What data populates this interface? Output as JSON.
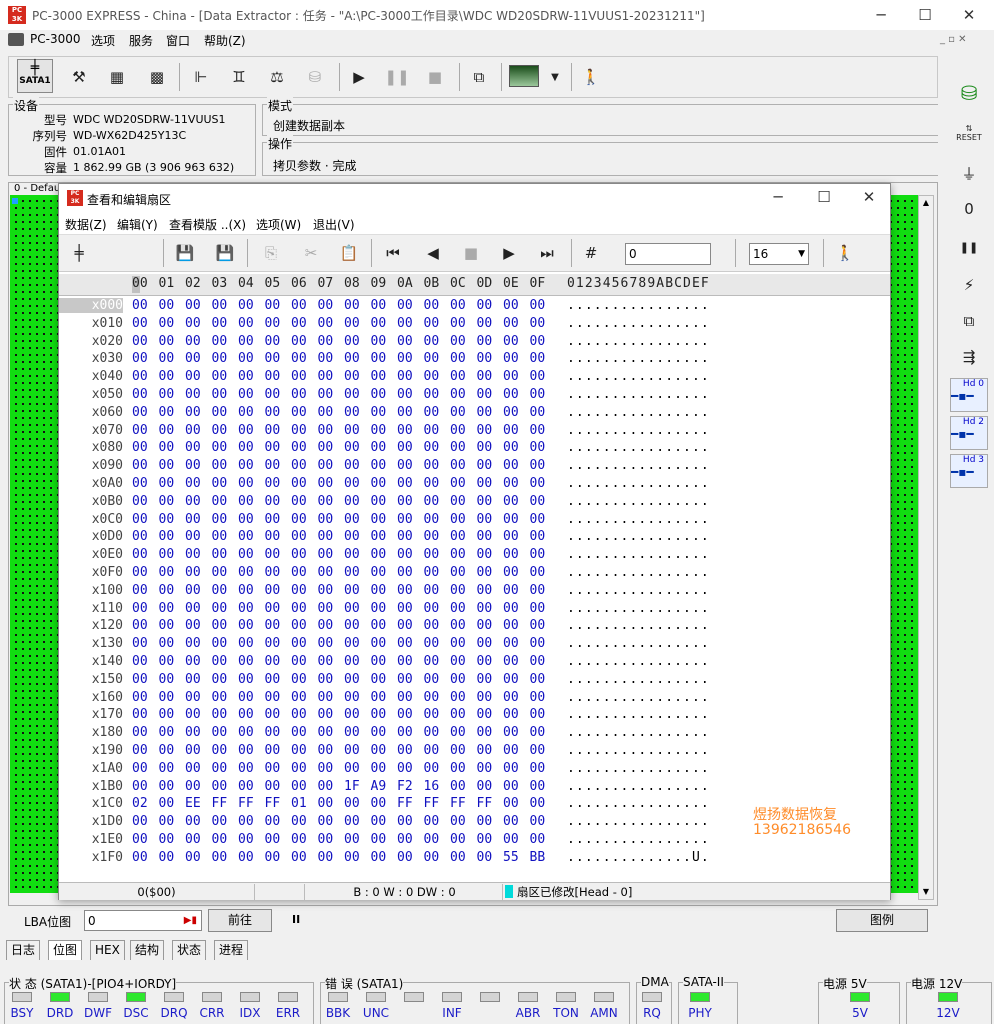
{
  "window": {
    "title": "PC-3000 EXPRESS - China - [Data Extractor : 任务 - \"A:\\PC-3000工作目录\\WDC WD20SDRW-11VUUS1-20231211\"]",
    "min": "─",
    "max": "☐",
    "close": "✕",
    "logo": "PC\n3K"
  },
  "menubar": {
    "items": [
      "PC-3000",
      "选项",
      "服务",
      "窗口",
      "帮助(Z)"
    ],
    "mdi": "_ ▫ ✕"
  },
  "toolbar": {
    "sata_label": "SATA1"
  },
  "device": {
    "group_label": "设备",
    "fields": [
      {
        "label": "型号",
        "value": "WDC WD20SDRW-11VUUS1"
      },
      {
        "label": "序列号",
        "value": "WD-WX62D425Y13C"
      },
      {
        "label": "固件",
        "value": "01.01A01"
      },
      {
        "label": "容量",
        "value": "1 862.99 GB (3 906 963 632)"
      }
    ]
  },
  "mode": {
    "group_label": "模式",
    "value": "创建数据副本"
  },
  "operation": {
    "group_label": "操作",
    "value": "拷贝参数 · 完成"
  },
  "bitmap_label": "0 - Defau",
  "dialog": {
    "title": "查看和编辑扇区",
    "menu": [
      "数据(Z)",
      "编辑(Y)",
      "查看模版 ..(X)",
      "选项(W)",
      "退出(V)"
    ],
    "offset_value": "0",
    "cols_value": "16",
    "header_cols": [
      "00",
      "01",
      "02",
      "03",
      "04",
      "05",
      "06",
      "07",
      "08",
      "09",
      "0A",
      "0B",
      "0C",
      "0D",
      "0E",
      "0F"
    ],
    "ascii_header": "0123456789ABCDEF",
    "rows": [
      {
        "addr": "x000",
        "bytes": [
          "00",
          "00",
          "00",
          "00",
          "00",
          "00",
          "00",
          "00",
          "00",
          "00",
          "00",
          "00",
          "00",
          "00",
          "00",
          "00"
        ],
        "ascii": "................"
      },
      {
        "addr": "x010",
        "bytes": [
          "00",
          "00",
          "00",
          "00",
          "00",
          "00",
          "00",
          "00",
          "00",
          "00",
          "00",
          "00",
          "00",
          "00",
          "00",
          "00"
        ],
        "ascii": "................"
      },
      {
        "addr": "x020",
        "bytes": [
          "00",
          "00",
          "00",
          "00",
          "00",
          "00",
          "00",
          "00",
          "00",
          "00",
          "00",
          "00",
          "00",
          "00",
          "00",
          "00"
        ],
        "ascii": "................"
      },
      {
        "addr": "x030",
        "bytes": [
          "00",
          "00",
          "00",
          "00",
          "00",
          "00",
          "00",
          "00",
          "00",
          "00",
          "00",
          "00",
          "00",
          "00",
          "00",
          "00"
        ],
        "ascii": "................"
      },
      {
        "addr": "x040",
        "bytes": [
          "00",
          "00",
          "00",
          "00",
          "00",
          "00",
          "00",
          "00",
          "00",
          "00",
          "00",
          "00",
          "00",
          "00",
          "00",
          "00"
        ],
        "ascii": "................"
      },
      {
        "addr": "x050",
        "bytes": [
          "00",
          "00",
          "00",
          "00",
          "00",
          "00",
          "00",
          "00",
          "00",
          "00",
          "00",
          "00",
          "00",
          "00",
          "00",
          "00"
        ],
        "ascii": "................"
      },
      {
        "addr": "x060",
        "bytes": [
          "00",
          "00",
          "00",
          "00",
          "00",
          "00",
          "00",
          "00",
          "00",
          "00",
          "00",
          "00",
          "00",
          "00",
          "00",
          "00"
        ],
        "ascii": "................"
      },
      {
        "addr": "x070",
        "bytes": [
          "00",
          "00",
          "00",
          "00",
          "00",
          "00",
          "00",
          "00",
          "00",
          "00",
          "00",
          "00",
          "00",
          "00",
          "00",
          "00"
        ],
        "ascii": "................"
      },
      {
        "addr": "x080",
        "bytes": [
          "00",
          "00",
          "00",
          "00",
          "00",
          "00",
          "00",
          "00",
          "00",
          "00",
          "00",
          "00",
          "00",
          "00",
          "00",
          "00"
        ],
        "ascii": "................"
      },
      {
        "addr": "x090",
        "bytes": [
          "00",
          "00",
          "00",
          "00",
          "00",
          "00",
          "00",
          "00",
          "00",
          "00",
          "00",
          "00",
          "00",
          "00",
          "00",
          "00"
        ],
        "ascii": "................"
      },
      {
        "addr": "x0A0",
        "bytes": [
          "00",
          "00",
          "00",
          "00",
          "00",
          "00",
          "00",
          "00",
          "00",
          "00",
          "00",
          "00",
          "00",
          "00",
          "00",
          "00"
        ],
        "ascii": "................"
      },
      {
        "addr": "x0B0",
        "bytes": [
          "00",
          "00",
          "00",
          "00",
          "00",
          "00",
          "00",
          "00",
          "00",
          "00",
          "00",
          "00",
          "00",
          "00",
          "00",
          "00"
        ],
        "ascii": "................"
      },
      {
        "addr": "x0C0",
        "bytes": [
          "00",
          "00",
          "00",
          "00",
          "00",
          "00",
          "00",
          "00",
          "00",
          "00",
          "00",
          "00",
          "00",
          "00",
          "00",
          "00"
        ],
        "ascii": "................"
      },
      {
        "addr": "x0D0",
        "bytes": [
          "00",
          "00",
          "00",
          "00",
          "00",
          "00",
          "00",
          "00",
          "00",
          "00",
          "00",
          "00",
          "00",
          "00",
          "00",
          "00"
        ],
        "ascii": "................"
      },
      {
        "addr": "x0E0",
        "bytes": [
          "00",
          "00",
          "00",
          "00",
          "00",
          "00",
          "00",
          "00",
          "00",
          "00",
          "00",
          "00",
          "00",
          "00",
          "00",
          "00"
        ],
        "ascii": "................"
      },
      {
        "addr": "x0F0",
        "bytes": [
          "00",
          "00",
          "00",
          "00",
          "00",
          "00",
          "00",
          "00",
          "00",
          "00",
          "00",
          "00",
          "00",
          "00",
          "00",
          "00"
        ],
        "ascii": "................"
      },
      {
        "addr": "x100",
        "bytes": [
          "00",
          "00",
          "00",
          "00",
          "00",
          "00",
          "00",
          "00",
          "00",
          "00",
          "00",
          "00",
          "00",
          "00",
          "00",
          "00"
        ],
        "ascii": "................"
      },
      {
        "addr": "x110",
        "bytes": [
          "00",
          "00",
          "00",
          "00",
          "00",
          "00",
          "00",
          "00",
          "00",
          "00",
          "00",
          "00",
          "00",
          "00",
          "00",
          "00"
        ],
        "ascii": "................"
      },
      {
        "addr": "x120",
        "bytes": [
          "00",
          "00",
          "00",
          "00",
          "00",
          "00",
          "00",
          "00",
          "00",
          "00",
          "00",
          "00",
          "00",
          "00",
          "00",
          "00"
        ],
        "ascii": "................"
      },
      {
        "addr": "x130",
        "bytes": [
          "00",
          "00",
          "00",
          "00",
          "00",
          "00",
          "00",
          "00",
          "00",
          "00",
          "00",
          "00",
          "00",
          "00",
          "00",
          "00"
        ],
        "ascii": "................"
      },
      {
        "addr": "x140",
        "bytes": [
          "00",
          "00",
          "00",
          "00",
          "00",
          "00",
          "00",
          "00",
          "00",
          "00",
          "00",
          "00",
          "00",
          "00",
          "00",
          "00"
        ],
        "ascii": "................"
      },
      {
        "addr": "x150",
        "bytes": [
          "00",
          "00",
          "00",
          "00",
          "00",
          "00",
          "00",
          "00",
          "00",
          "00",
          "00",
          "00",
          "00",
          "00",
          "00",
          "00"
        ],
        "ascii": "................"
      },
      {
        "addr": "x160",
        "bytes": [
          "00",
          "00",
          "00",
          "00",
          "00",
          "00",
          "00",
          "00",
          "00",
          "00",
          "00",
          "00",
          "00",
          "00",
          "00",
          "00"
        ],
        "ascii": "................"
      },
      {
        "addr": "x170",
        "bytes": [
          "00",
          "00",
          "00",
          "00",
          "00",
          "00",
          "00",
          "00",
          "00",
          "00",
          "00",
          "00",
          "00",
          "00",
          "00",
          "00"
        ],
        "ascii": "................"
      },
      {
        "addr": "x180",
        "bytes": [
          "00",
          "00",
          "00",
          "00",
          "00",
          "00",
          "00",
          "00",
          "00",
          "00",
          "00",
          "00",
          "00",
          "00",
          "00",
          "00"
        ],
        "ascii": "................"
      },
      {
        "addr": "x190",
        "bytes": [
          "00",
          "00",
          "00",
          "00",
          "00",
          "00",
          "00",
          "00",
          "00",
          "00",
          "00",
          "00",
          "00",
          "00",
          "00",
          "00"
        ],
        "ascii": "................"
      },
      {
        "addr": "x1A0",
        "bytes": [
          "00",
          "00",
          "00",
          "00",
          "00",
          "00",
          "00",
          "00",
          "00",
          "00",
          "00",
          "00",
          "00",
          "00",
          "00",
          "00"
        ],
        "ascii": "................"
      },
      {
        "addr": "x1B0",
        "bytes": [
          "00",
          "00",
          "00",
          "00",
          "00",
          "00",
          "00",
          "00",
          "1F",
          "A9",
          "F2",
          "16",
          "00",
          "00",
          "00",
          "00"
        ],
        "ascii": "................"
      },
      {
        "addr": "x1C0",
        "bytes": [
          "02",
          "00",
          "EE",
          "FF",
          "FF",
          "FF",
          "01",
          "00",
          "00",
          "00",
          "FF",
          "FF",
          "FF",
          "FF",
          "00",
          "00"
        ],
        "ascii": "................"
      },
      {
        "addr": "x1D0",
        "bytes": [
          "00",
          "00",
          "00",
          "00",
          "00",
          "00",
          "00",
          "00",
          "00",
          "00",
          "00",
          "00",
          "00",
          "00",
          "00",
          "00"
        ],
        "ascii": "................"
      },
      {
        "addr": "x1E0",
        "bytes": [
          "00",
          "00",
          "00",
          "00",
          "00",
          "00",
          "00",
          "00",
          "00",
          "00",
          "00",
          "00",
          "00",
          "00",
          "00",
          "00"
        ],
        "ascii": "................"
      },
      {
        "addr": "x1F0",
        "bytes": [
          "00",
          "00",
          "00",
          "00",
          "00",
          "00",
          "00",
          "00",
          "00",
          "00",
          "00",
          "00",
          "00",
          "00",
          "55",
          "BB"
        ],
        "ascii": "..............U."
      }
    ],
    "watermark": [
      "煜扬数据恢复",
      "13962186546"
    ],
    "status": {
      "offset": "0($00)",
      "bwdw": "B : 0 W : 0 DW : 0",
      "modified": "扇区已修改[Head - 0]"
    }
  },
  "lba": {
    "label": "LBA位图",
    "value": "0",
    "goto": "前往",
    "pause": "II",
    "legend": "图例"
  },
  "tabs": [
    "日志",
    "位图",
    "HEX",
    "结构",
    "状态",
    "进程"
  ],
  "status": {
    "state_label": "状 态 (SATA1)-[PIO4+IORDY]",
    "state_leds": [
      {
        "name": "BSY",
        "on": false
      },
      {
        "name": "DRD",
        "on": true
      },
      {
        "name": "DWF",
        "on": false
      },
      {
        "name": "DSC",
        "on": true
      },
      {
        "name": "DRQ",
        "on": false
      },
      {
        "name": "CRR",
        "on": false
      },
      {
        "name": "IDX",
        "on": false
      },
      {
        "name": "ERR",
        "on": false
      }
    ],
    "error_label": "错 误 (SATA1)",
    "error_leds": [
      {
        "name": "BBK",
        "on": false
      },
      {
        "name": "UNC",
        "on": false
      },
      {
        "name": "",
        "on": false
      },
      {
        "name": "INF",
        "on": false
      },
      {
        "name": "",
        "on": false
      },
      {
        "name": "ABR",
        "on": false
      },
      {
        "name": "TON",
        "on": false
      },
      {
        "name": "AMN",
        "on": false
      }
    ],
    "dma_label": "DMA",
    "dma_led": {
      "name": "RQ",
      "on": false
    },
    "sata2_label": "SATA-II",
    "sata2_led": {
      "name": "PHY",
      "on": true
    },
    "p5_label": "电源 5V",
    "p5_led": {
      "name": "5V",
      "on": true
    },
    "p12_label": "电源 12V",
    "p12_led": {
      "name": "12V",
      "on": true
    }
  },
  "right_toolbar": {
    "hd_buttons": [
      "Hd 0",
      "Hd 2",
      "Hd 3"
    ],
    "reset": "RESET"
  }
}
